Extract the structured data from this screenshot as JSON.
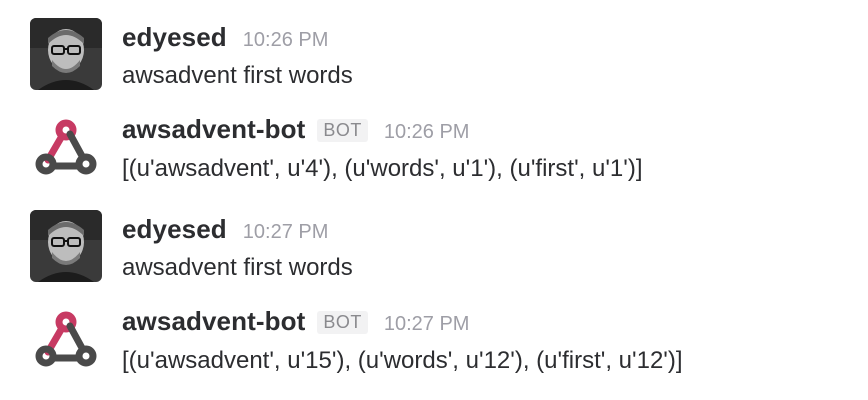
{
  "messages": [
    {
      "author": "edyesed",
      "badge": "",
      "time": "10:26 PM",
      "text": "awsadvent first words",
      "avatar": "user-photo"
    },
    {
      "author": "awsadvent-bot",
      "badge": "BOT",
      "time": "10:26 PM",
      "text": "[(u'awsadvent', u'4'), (u'words', u'1'), (u'first', u'1')]",
      "avatar": "webhook-icon"
    },
    {
      "author": "edyesed",
      "badge": "",
      "time": "10:27 PM",
      "text": "awsadvent first words",
      "avatar": "user-photo"
    },
    {
      "author": "awsadvent-bot",
      "badge": "BOT",
      "time": "10:27 PM",
      "text": "[(u'awsadvent', u'15'), (u'words', u'12'), (u'first', u'12')]",
      "avatar": "webhook-icon"
    }
  ],
  "colors": {
    "text": "#2c2d30",
    "muted": "#9e9ea6",
    "webhook_red": "#c73a63",
    "webhook_dark": "#4a4a4a"
  }
}
